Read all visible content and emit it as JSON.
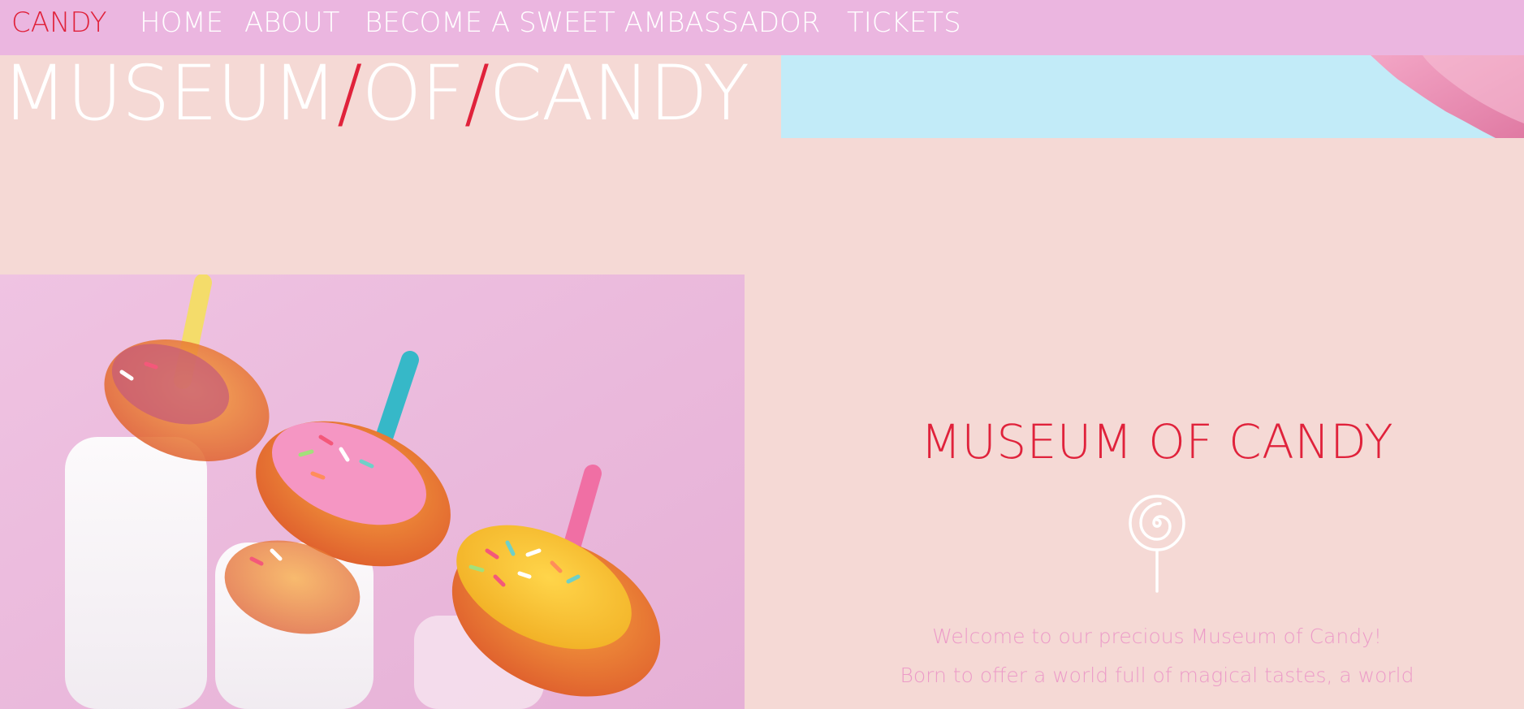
{
  "nav": {
    "brand": "CANDY",
    "links": [
      "HOME",
      "ABOUT",
      "BECOME A SWEET AMBASSADOR",
      "TICKETS"
    ]
  },
  "hero": {
    "title_parts": [
      "MUSEUM",
      "/",
      "OF",
      "/",
      "CANDY"
    ]
  },
  "intro": {
    "title": "MUSEUM OF CANDY",
    "icon": "lollipop-icon",
    "lines": [
      "Welcome to our precious Museum of Candy!",
      "Born to offer a world full of magical tastes, a world"
    ]
  },
  "images": {
    "photo": "donuts-with-straws-on-milk-bottles"
  },
  "colors": {
    "navbar": "#ebb6e0",
    "background": "#f5d9d5",
    "accent_red": "#e0223b",
    "banner_blue": "#c2ebf8",
    "text_pink": "#ec9bc8"
  }
}
